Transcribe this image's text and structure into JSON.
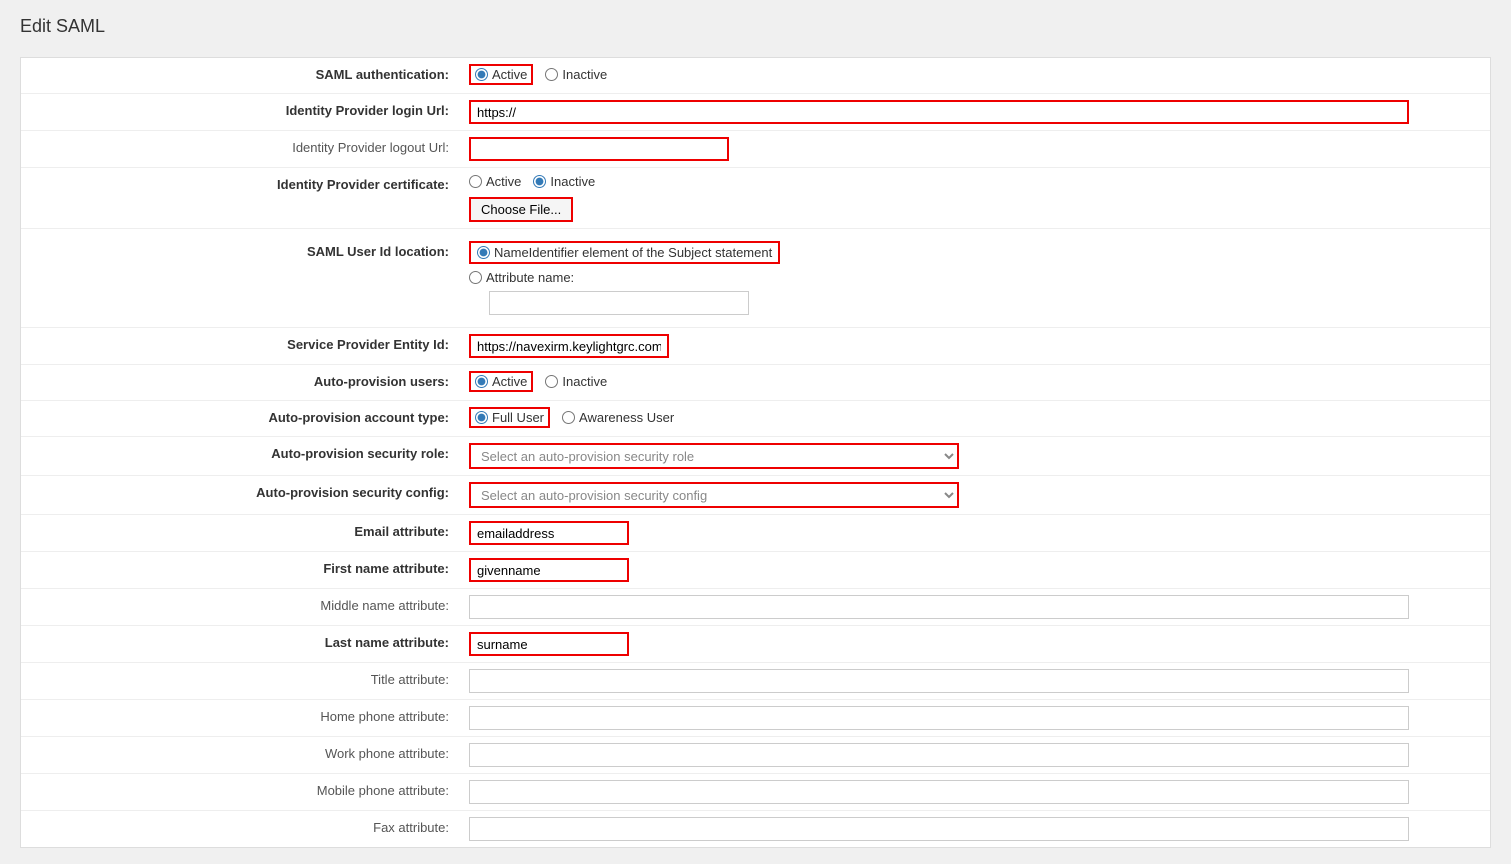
{
  "page": {
    "title": "Edit SAML"
  },
  "form": {
    "fields": [
      {
        "id": "saml-auth",
        "label": "SAML authentication:",
        "type": "radio",
        "options": [
          "Active",
          "Inactive"
        ],
        "selected": "Active",
        "bold": true,
        "highlight_selected": true
      },
      {
        "id": "idp-login-url",
        "label": "Identity Provider login Url:",
        "type": "text",
        "value": "https://",
        "bold": true,
        "highlight": true,
        "width": "full"
      },
      {
        "id": "idp-logout-url",
        "label": "Identity Provider logout Url:",
        "type": "text",
        "value": "",
        "bold": false,
        "highlight": true,
        "width": "medium"
      },
      {
        "id": "idp-certificate",
        "label": "Identity Provider certificate:",
        "type": "radio-file",
        "radio_options": [
          "Active",
          "Inactive"
        ],
        "selected": "Inactive",
        "file_button_label": "Choose File...",
        "bold": true
      },
      {
        "id": "saml-user-id-location",
        "label": "SAML User Id location:",
        "type": "radio-with-input",
        "options": [
          "NameIdentifier element of the Subject statement",
          "Attribute name:"
        ],
        "selected": "NameIdentifier element of the Subject statement",
        "bold": true,
        "highlight_selected": true
      },
      {
        "id": "service-provider-entity-id",
        "label": "Service Provider Entity Id:",
        "type": "text",
        "value": "https://navexirm.keylightgrc.com/",
        "bold": true,
        "highlight": true,
        "width": "service"
      },
      {
        "id": "auto-provision-users",
        "label": "Auto-provision users:",
        "type": "radio",
        "options": [
          "Active",
          "Inactive"
        ],
        "selected": "Active",
        "bold": true,
        "highlight_selected": true
      },
      {
        "id": "auto-provision-account-type",
        "label": "Auto-provision account type:",
        "type": "radio",
        "options": [
          "Full User",
          "Awareness User"
        ],
        "selected": "Full User",
        "bold": true,
        "highlight_selected": true
      },
      {
        "id": "auto-provision-security-role",
        "label": "Auto-provision security role:",
        "type": "select",
        "placeholder": "Select an auto-provision security role",
        "bold": true,
        "highlight": true
      },
      {
        "id": "auto-provision-security-config",
        "label": "Auto-provision security config:",
        "type": "select",
        "placeholder": "Select an auto-provision security config",
        "bold": true,
        "highlight": true
      },
      {
        "id": "email-attribute",
        "label": "Email attribute:",
        "type": "text",
        "value": "emailaddress",
        "bold": true,
        "highlight": true,
        "width": "short"
      },
      {
        "id": "first-name-attribute",
        "label": "First name attribute:",
        "type": "text",
        "value": "givenname",
        "bold": true,
        "highlight": true,
        "width": "short"
      },
      {
        "id": "middle-name-attribute",
        "label": "Middle name attribute:",
        "type": "text",
        "value": "",
        "bold": false,
        "highlight": false,
        "width": "full"
      },
      {
        "id": "last-name-attribute",
        "label": "Last name attribute:",
        "type": "text",
        "value": "surname",
        "bold": true,
        "highlight": true,
        "width": "short"
      },
      {
        "id": "title-attribute",
        "label": "Title attribute:",
        "type": "text",
        "value": "",
        "bold": false,
        "highlight": false,
        "width": "full"
      },
      {
        "id": "home-phone-attribute",
        "label": "Home phone attribute:",
        "type": "text",
        "value": "",
        "bold": false,
        "highlight": false,
        "width": "full"
      },
      {
        "id": "work-phone-attribute",
        "label": "Work phone attribute:",
        "type": "text",
        "value": "",
        "bold": false,
        "highlight": false,
        "width": "full"
      },
      {
        "id": "mobile-phone-attribute",
        "label": "Mobile phone attribute:",
        "type": "text",
        "value": "",
        "bold": false,
        "highlight": false,
        "width": "full"
      },
      {
        "id": "fax-attribute",
        "label": "Fax attribute:",
        "type": "text",
        "value": "",
        "bold": false,
        "highlight": false,
        "width": "full"
      }
    ]
  }
}
